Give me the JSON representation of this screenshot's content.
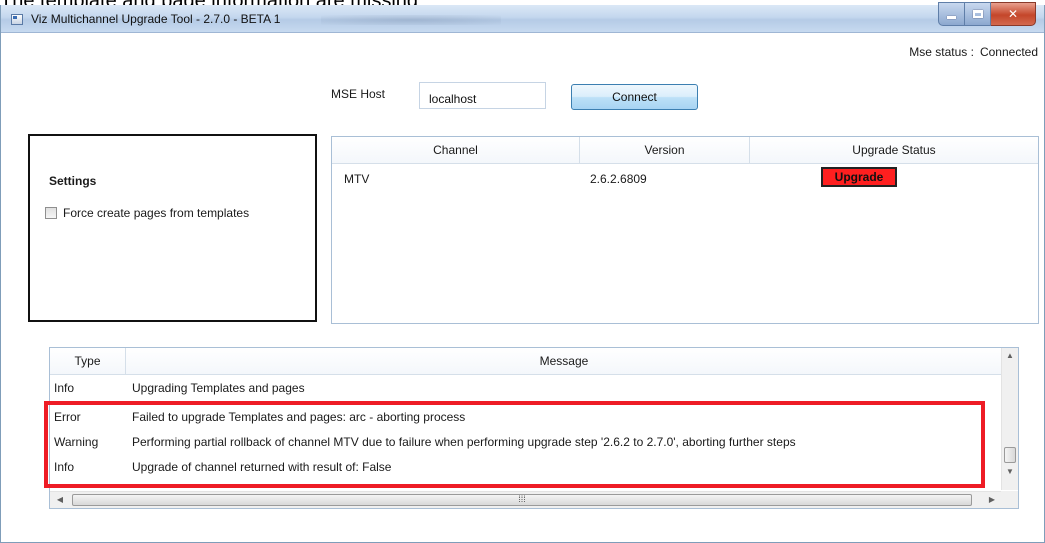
{
  "caption": "The template and page information are missing",
  "window": {
    "title": "Viz Multichannel Upgrade Tool - 2.7.0 - BETA 1"
  },
  "status": {
    "label": "Mse status :",
    "value": "Connected"
  },
  "host": {
    "label": "MSE Host",
    "value": "localhost",
    "connect_label": "Connect"
  },
  "settings": {
    "title": "Settings",
    "force_create_label": "Force create pages from templates",
    "force_create_checked": false
  },
  "channels": {
    "columns": [
      "Channel",
      "Version",
      "Upgrade Status"
    ],
    "rows": [
      {
        "channel": "MTV",
        "version": "2.6.2.6809",
        "status_button": "Upgrade"
      }
    ],
    "upgrade_color": "#ff1f1f"
  },
  "log": {
    "columns": [
      "Type",
      "Message"
    ],
    "rows": [
      {
        "type": "Info",
        "message": "Upgrading Templates and pages"
      },
      {
        "type": "Error",
        "message": "Failed to upgrade Templates and pages: arc - aborting process"
      },
      {
        "type": "Warning",
        "message": "Performing partial rollback of channel MTV due to failure when performing upgrade step '2.6.2 to 2.7.0', aborting further steps"
      },
      {
        "type": "Info",
        "message": "Upgrade of channel returned with result of: False"
      }
    ],
    "highlight_color": "#ee1c25"
  }
}
